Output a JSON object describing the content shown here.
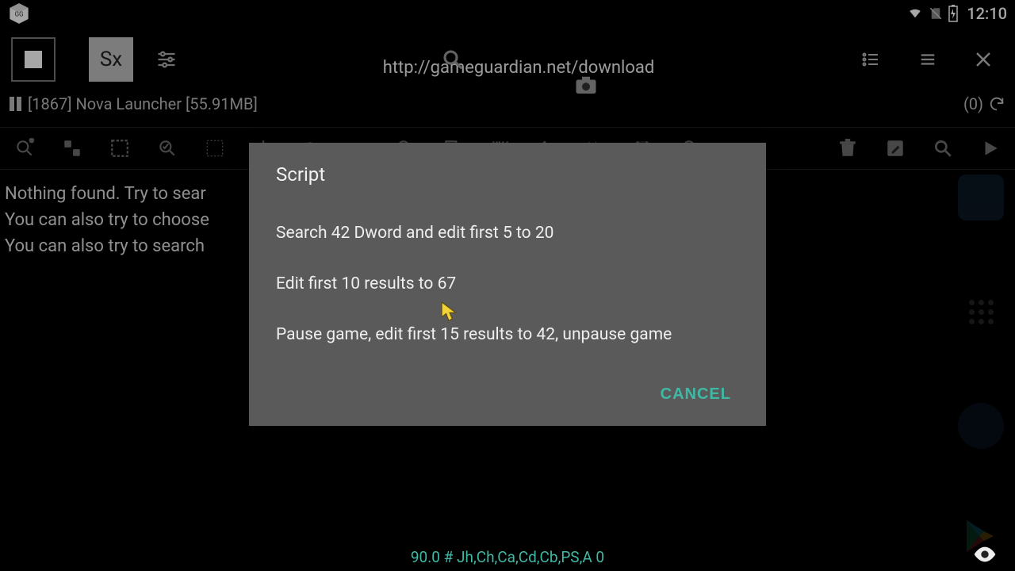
{
  "status": {
    "time": "12:10"
  },
  "topbar": {
    "sx_label": "Sx",
    "url": "http://gameguardian.net/download"
  },
  "process": {
    "line": "[1867] Nova Launcher [55.91MB]",
    "count": "(0)"
  },
  "body": {
    "l1": "Nothing found. Try to sear",
    "l2": "You can also try to choose",
    "l3": "You can also try to search"
  },
  "dialog": {
    "title": "Script",
    "opts": [
      "Search 42 Dword and edit first 5 to 20",
      "Edit first 10 results to 67",
      "Pause game, edit first 15 results to 42, unpause game"
    ],
    "cancel": "CANCEL"
  },
  "bottom": {
    "text": "90.0 # Jh,Ch,Ca,Cd,Cb,PS,A 0"
  }
}
